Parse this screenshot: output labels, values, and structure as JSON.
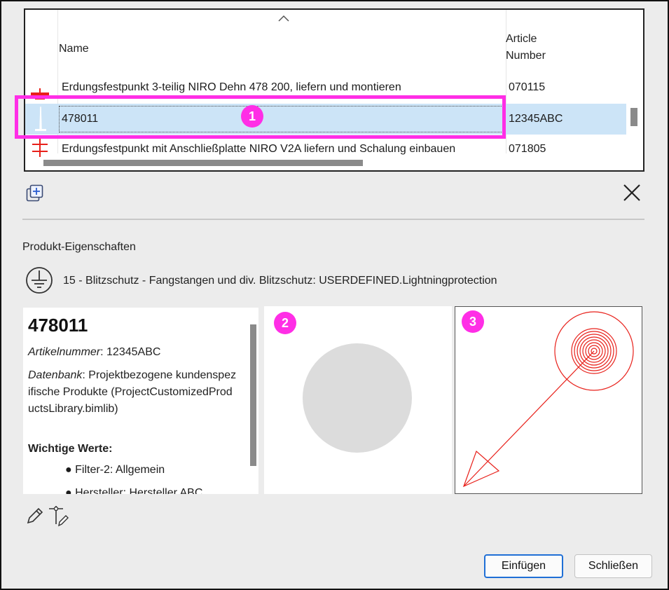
{
  "table": {
    "columns": {
      "name": "Name",
      "article_number": "Article\nNumber"
    },
    "rows": [
      {
        "name": "Erdungsfestpunkt 3-teilig NIRO Dehn 478  200, liefern und montieren",
        "article": "070115"
      },
      {
        "name": "478011",
        "article": "12345ABC"
      },
      {
        "name": "Erdungsfestpunkt mit Anschließplatte NIRO V2A liefern und Schalung einbauen",
        "article": "071805"
      }
    ]
  },
  "annotations": {
    "badge1": "1",
    "badge2": "2",
    "badge3": "3"
  },
  "section_title": "Produkt-Eigenschaften",
  "category_line": "15 - Blitzschutz - Fangstangen und div. Blitzschutz: USERDEFINED.Lightningprotection",
  "details": {
    "title": "478011",
    "artikel_label": "Artikelnummer",
    "artikel_value": ": 12345ABC",
    "datenbank_label": "Datenbank",
    "datenbank_value": ": Projektbezogene kundenspezifische Produkte (ProjectCustomizedProductsLibrary.bimlib)",
    "wichtige_werte": "Wichtige Werte:",
    "bullets": [
      "Filter-2: Allgemein",
      "Hersteller: Hersteller ABC"
    ]
  },
  "buttons": {
    "insert": "Einfügen",
    "close": "Schließen"
  },
  "icons": {
    "sort": "chevron-up-icon",
    "add": "add-copy-icon",
    "close": "close-icon",
    "ground": "ground-symbol-icon",
    "edit": "pencil-icon",
    "edit_symbol": "edit-symbol-icon"
  },
  "colors": {
    "highlight": "#ff2ee6",
    "selection": "#cce4f7",
    "symbol_red": "#e8201a",
    "accent": "#1f6fd6"
  }
}
